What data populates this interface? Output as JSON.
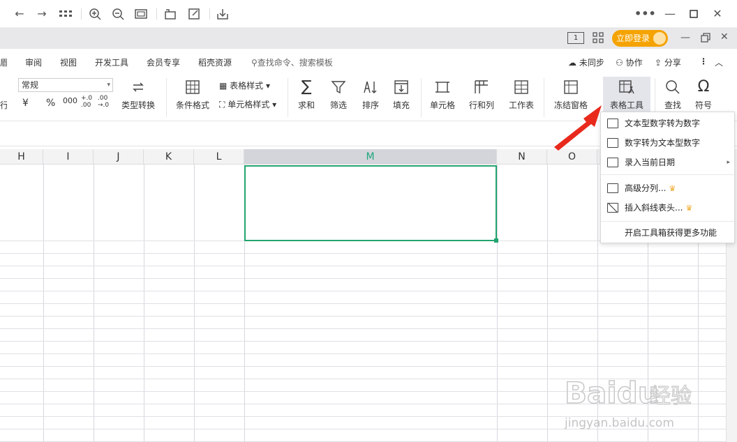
{
  "titlebar": {
    "icons": [
      "back-icon",
      "forward-icon",
      "apps-grid-icon",
      "zoom-in-icon",
      "zoom-out-icon",
      "fit-page-icon",
      "rotate-icon",
      "edit-icon",
      "download-icon",
      "more-icon",
      "minimize-icon",
      "maximize-icon",
      "close-icon"
    ]
  },
  "accountbar": {
    "login_label": "立即登录",
    "icons": [
      "reading-mode-icon",
      "layout-icon",
      "minimize-icon",
      "restore-icon",
      "close-icon"
    ]
  },
  "tabs": {
    "partial": "眉",
    "items": [
      "审阅",
      "视图",
      "开发工具",
      "会员专享",
      "稻壳资源"
    ],
    "search_placeholder": "查找命令、搜索模板",
    "unsynced": "未同步",
    "collaborate": "协作",
    "share": "分享"
  },
  "ribbon": {
    "partial_left": "行",
    "number_format": "常规",
    "currency_symbol": "¥",
    "percent": "%",
    "thousands": "000",
    "inc_decimal": "+.0\n.00",
    "dec_decimal": ".00\n→.0",
    "type_convert": "类型转换",
    "conditional_format": "条件格式",
    "table_style": "表格样式",
    "cell_style": "单元格样式",
    "sum": "求和",
    "filter": "筛选",
    "sort": "排序",
    "fill": "填充",
    "cell": "单元格",
    "row_col": "行和列",
    "worksheet": "工作表",
    "freeze": "冻结窗格",
    "table_tools": "表格工具",
    "find": "查找",
    "symbol": "符号"
  },
  "grid": {
    "columns": [
      "H",
      "I",
      "J",
      "K",
      "L",
      "M",
      "N",
      "O"
    ],
    "selected_column": "M",
    "selection_color": "#22a46f"
  },
  "dropdown": {
    "items": [
      {
        "label": "文本型数字转为数字",
        "icon": "text-to-number-icon"
      },
      {
        "label": "数字转为文本型数字",
        "icon": "number-to-text-icon"
      },
      {
        "label": "录入当前日期",
        "icon": "calendar-icon",
        "submenu": true
      },
      {
        "label": "高级分列...",
        "icon": "split-column-icon",
        "premium": true
      },
      {
        "label": "插入斜线表头...",
        "icon": "diagonal-header-icon",
        "premium": true
      }
    ],
    "footer": "开启工具箱获得更多功能"
  },
  "annotation": {
    "arrow_color": "#e8291c"
  },
  "watermark": {
    "brand": "Baidu",
    "brand_cn": "经验",
    "url": "jingyan.baidu.com"
  }
}
